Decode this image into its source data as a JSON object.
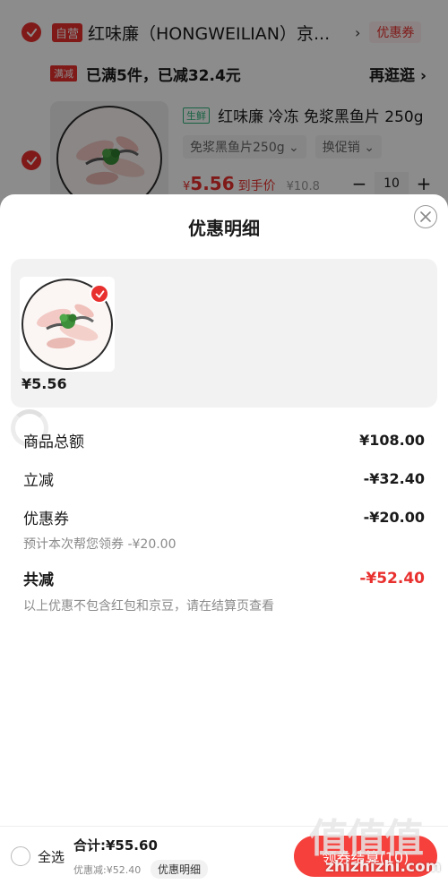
{
  "cart": {
    "self_operated_tag": "自营",
    "shop_name": "红味廉（HONGWEILIAN）京...",
    "shop_arrow": "›",
    "coupon_link": "优惠券",
    "promo_tag": "满减",
    "promo_text": "已满5件，已减32.4元",
    "promo_more": "再逛逛 ›",
    "item": {
      "fresh_tag": "生鲜",
      "name": "红味廉 冷冻 免浆黑鱼片 250g",
      "spec": "免浆黑鱼片250g ⌄",
      "promo_chip": "换促销 ⌄",
      "price_symbol": "¥",
      "price": "5.56",
      "price_suffix": "到手价",
      "original_price": "¥10.8",
      "minus": "−",
      "quantity": "10",
      "plus": "+"
    }
  },
  "sheet": {
    "title": "优惠明细",
    "goods_price": "¥5.56",
    "rows": {
      "goods_total_label": "商品总额",
      "goods_total": "¥108.00",
      "direct_label": "立减",
      "direct": "-¥32.40",
      "coupon_label": "优惠券",
      "coupon": "-¥20.00",
      "coupon_note": "预计本次帮您领券 -¥20.00",
      "total_label": "共减",
      "total": "-¥52.40",
      "footnote": "以上优惠不包含红包和京豆，请在结算页查看"
    }
  },
  "bottom_bar": {
    "select_all": "全选",
    "total": "合计:¥55.60",
    "discount": "优惠减:¥52.40",
    "detail_chip": "优惠明细",
    "checkout": "领券结算(10)"
  },
  "watermark": {
    "big": "值值值",
    "small": "zhizhizhi.com"
  },
  "colors": {
    "accent": "#e8302e",
    "fresh": "#2db37a"
  },
  "icons": [
    "check-icon",
    "close-icon",
    "spinner-icon"
  ]
}
